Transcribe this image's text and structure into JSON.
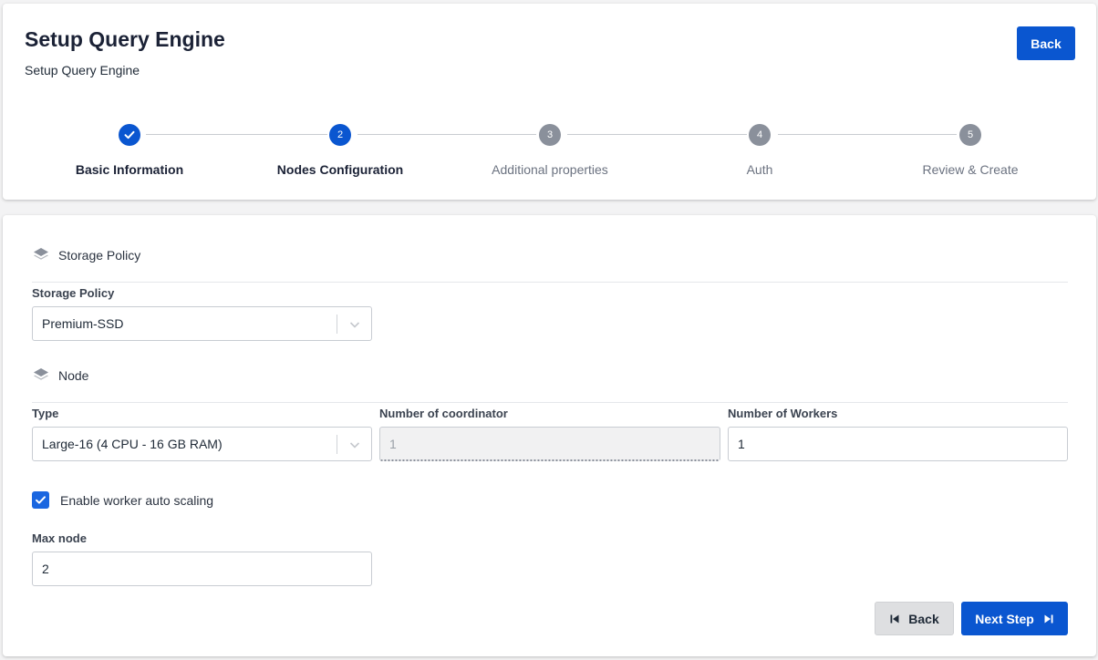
{
  "header": {
    "title": "Setup Query Engine",
    "subtitle": "Setup Query Engine",
    "back_label": "Back"
  },
  "stepper": {
    "steps": [
      {
        "number": "1",
        "label": "Basic Information",
        "state": "done"
      },
      {
        "number": "2",
        "label": "Nodes Configuration",
        "state": "active"
      },
      {
        "number": "3",
        "label": "Additional properties",
        "state": "todo"
      },
      {
        "number": "4",
        "label": "Auth",
        "state": "todo"
      },
      {
        "number": "5",
        "label": "Review & Create",
        "state": "todo"
      }
    ]
  },
  "storage": {
    "section_title": "Storage Policy",
    "field_label": "Storage Policy",
    "value": "Premium-SSD"
  },
  "node": {
    "section_title": "Node",
    "type_label": "Type",
    "type_value": "Large-16 (4 CPU - 16 GB RAM)",
    "coordinator_label": "Number of coordinator",
    "coordinator_value": "1",
    "workers_label": "Number of Workers",
    "workers_value": "1"
  },
  "autoscaling": {
    "checked": true,
    "label": "Enable worker auto scaling",
    "max_node_label": "Max node",
    "max_node_value": "2"
  },
  "footer": {
    "back_label": "Back",
    "next_label": "Next Step"
  },
  "colors": {
    "primary": "#0a56d0",
    "step_inactive": "#8a909b"
  }
}
